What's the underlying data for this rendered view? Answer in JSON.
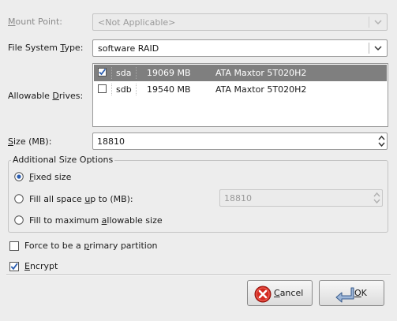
{
  "form": {
    "mount_point_label": "Mount Point:",
    "mount_point_value": "<Not Applicable>",
    "fs_type_label": "File System Type:",
    "fs_type_value": "software RAID",
    "allowable_drives_label": "Allowable Drives:",
    "drives": [
      {
        "checked": true,
        "name": "sda",
        "size": "19069 MB",
        "model": "ATA Maxtor 5T020H2",
        "selected": true
      },
      {
        "checked": false,
        "name": "sdb",
        "size": "19540 MB",
        "model": "ATA Maxtor 5T020H2",
        "selected": false
      }
    ],
    "size_label": "Size (MB):",
    "size_value": "18810"
  },
  "size_options": {
    "title": "Additional Size Options",
    "fixed_label": "Fixed size",
    "fill_upto_label": "Fill all space up to (MB):",
    "fill_upto_value": "18810",
    "fill_max_label": "Fill to maximum allowable size",
    "selected": "fixed"
  },
  "options": {
    "primary_label": "Force to be a primary partition",
    "primary_checked": false,
    "encrypt_label": "Encrypt",
    "encrypt_checked": true
  },
  "buttons": {
    "cancel": "Cancel",
    "ok": "OK"
  },
  "icons": {
    "cancel": "red-circle-x-icon",
    "ok": "enter-arrow-icon"
  },
  "colors": {
    "selection": "#7f7f7f",
    "cancel_red": "#d42a20",
    "check_blue": "#2a5db0"
  }
}
